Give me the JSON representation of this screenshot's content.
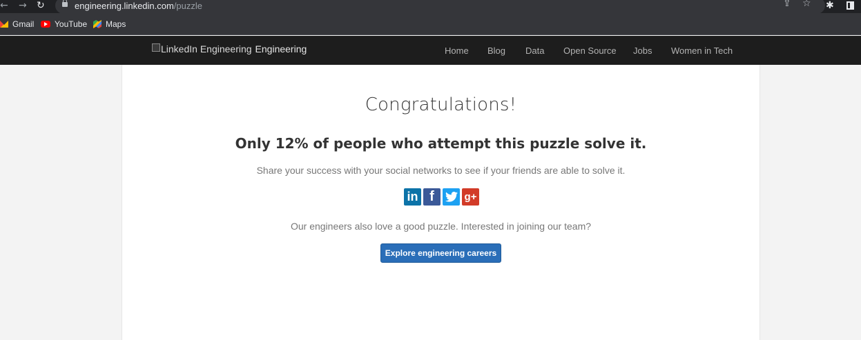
{
  "browser": {
    "url_host": "engineering.linkedin.com",
    "url_path": "/puzzle",
    "back_glyph": "←",
    "forward_glyph": "→",
    "reload_glyph": "↻",
    "share_glyph": "⇪",
    "star_glyph": "☆",
    "extension_glyph": "✱",
    "bookmarks": [
      {
        "label": "Gmail",
        "icon": "gmail-icon"
      },
      {
        "label": "YouTube",
        "icon": "youtube-icon"
      },
      {
        "label": "Maps",
        "icon": "maps-icon"
      }
    ]
  },
  "site": {
    "logo_alt": "LinkedIn Engineering",
    "logo_text": "Engineering",
    "nav": [
      "Home",
      "Blog",
      "Data",
      "Open Source",
      "Jobs",
      "Women in Tech"
    ]
  },
  "main": {
    "heading": "Congratulations!",
    "stat_text": "Only 12% of people who attempt this puzzle solve it.",
    "share_text": "Share your success with your social networks to see if your friends are able to solve it.",
    "social": {
      "linkedin": "in",
      "facebook": "f",
      "twitter": "t",
      "googleplus": "g+"
    },
    "join_text": "Our engineers also love a good puzzle. Interested in joining our team?",
    "cta_label": "Explore engineering careers"
  },
  "colors": {
    "header_bg": "#1d1d1d",
    "cta_bg": "#2a6eb8",
    "linkedin": "#0c73a8",
    "facebook": "#3b5998",
    "twitter": "#1da1f2",
    "googleplus": "#d23b28"
  }
}
